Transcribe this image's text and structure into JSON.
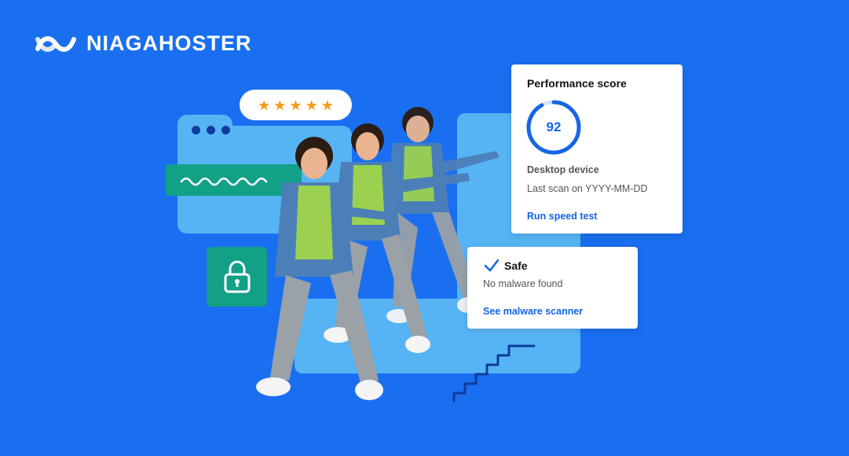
{
  "brand": {
    "name": "NIAGAHOSTER",
    "icon": "niagahoster-wave-logo"
  },
  "rating": {
    "stars": 5,
    "max": 5
  },
  "performance_card": {
    "title": "Performance score",
    "score": "92",
    "score_fraction": 0.92,
    "device": "Desktop device",
    "last_scan": "Last scan on YYYY-MM-DD",
    "link": "Run speed test"
  },
  "security_card": {
    "status": "Safe",
    "message": "No malware found",
    "link": "See malware scanner",
    "icon": "check-icon"
  },
  "colors": {
    "background": "#1a6ff0",
    "panel": "#56b4f5",
    "green": "#12a086",
    "accent": "#1565e6",
    "star": "#f59a16",
    "navy": "#0e3b9c"
  }
}
